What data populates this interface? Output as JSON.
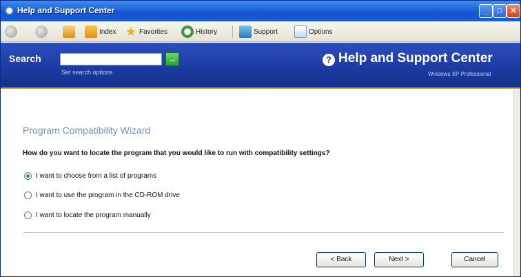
{
  "window": {
    "title": "Help and Support Center",
    "min_glyph": "_",
    "max_glyph": "□",
    "close_glyph": "✕"
  },
  "toolbar": {
    "index_label": "Index",
    "favorites_label": "Favorites",
    "history_label": "History",
    "support_label": "Support",
    "options_label": "Options"
  },
  "header": {
    "search_label": "Search",
    "search_value": "",
    "search_go_glyph": "→",
    "search_options": "Set search options",
    "help_icon_glyph": "?",
    "title": "Help and Support Center",
    "subtitle": "Windows XP Professional"
  },
  "wizard": {
    "title": "Program Compatibility Wizard",
    "question": "How do you want to locate the program that you would like to run with compatibility settings?",
    "options": [
      {
        "label": "I want to choose from a list of programs",
        "checked": true
      },
      {
        "label": "I want to use the program in the CD-ROM drive",
        "checked": false
      },
      {
        "label": "I want to locate the program manually",
        "checked": false
      }
    ],
    "back_label": "< Back",
    "next_label": "Next >",
    "cancel_label": "Cancel"
  },
  "colors": {
    "titlebar": "#1f63d6",
    "header_band": "#1b3aa0",
    "wizard_title": "#6f8fd3",
    "accent_stripe": "#e6a23a"
  }
}
